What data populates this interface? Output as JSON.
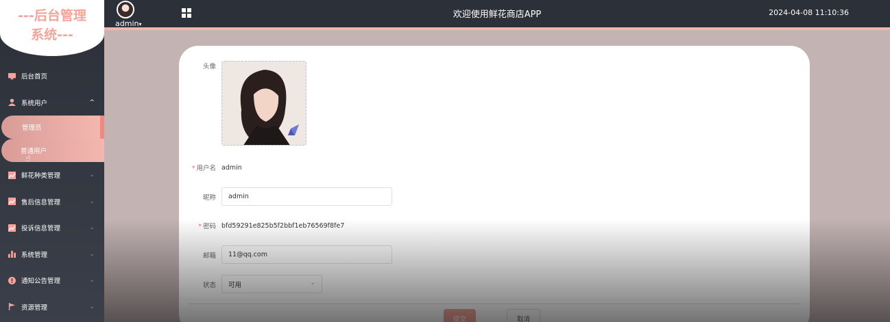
{
  "logo": {
    "line1": "---后台管理",
    "line2": "系统---"
  },
  "header": {
    "username": "admin",
    "dropdown_glyph": "▾",
    "title": "欢迎使用鲜花商店APP",
    "datetime": "2024-04-08 11:10:36"
  },
  "sidebar": {
    "items": [
      {
        "label": "后台首页",
        "icon": "monitor-icon",
        "color": "#f4a49a"
      },
      {
        "label": "系统用户",
        "icon": "user-icon",
        "color": "#f4a49a",
        "arrow": "^"
      },
      {
        "label": "鲜花种类管理",
        "icon": "chart-icon",
        "color": "#f4a49a",
        "arrow": "⌄"
      },
      {
        "label": "售后信息管理",
        "icon": "chart-icon",
        "color": "#f4a49a",
        "arrow": "⌄"
      },
      {
        "label": "投诉信息管理",
        "icon": "chart-icon",
        "color": "#f4a49a",
        "arrow": "⌄"
      },
      {
        "label": "系统管理",
        "icon": "bar-chart-icon",
        "color": "#f4a49a",
        "arrow": "⌄"
      },
      {
        "label": "通知公告管理",
        "icon": "info-icon",
        "color": "#f4a49a",
        "arrow": "⌄"
      },
      {
        "label": "资源管理",
        "icon": "flag-icon",
        "color": "#f4a49a",
        "arrow": "⌄"
      }
    ],
    "sub_items": [
      {
        "label": "管理员"
      },
      {
        "label": "普通用户"
      }
    ]
  },
  "form": {
    "avatar_label": "头像",
    "username_label": "用户名",
    "username_value": "admin",
    "nickname_label": "昵称",
    "nickname_value": "admin",
    "password_label": "密码",
    "password_value": "bfd59291e825b5f2bbf1eb76569f8fe7",
    "email_label": "邮箱",
    "email_value": "11@qq.com",
    "status_label": "状态",
    "status_value": "可用",
    "required_mark": "*",
    "submit_label": "提交",
    "cancel_label": "取消"
  },
  "colors": {
    "accent": "#f4a49a",
    "sidebar_bg": "#2c3039",
    "content_bg": "#c3b3b3"
  }
}
